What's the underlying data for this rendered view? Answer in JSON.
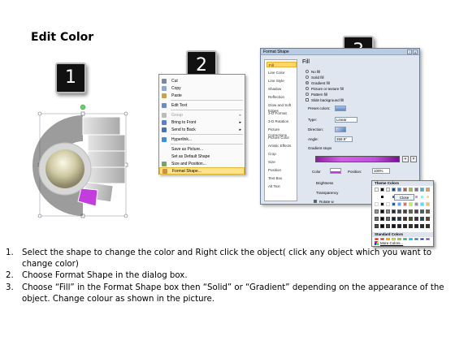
{
  "title": "Edit Color",
  "badges": [
    "1",
    "2",
    "3"
  ],
  "colors": {
    "badge_bg": "#111111",
    "highlight_segment": "#c33cdd",
    "menu_highlight": "#ffe38a",
    "dialog_bg": "#dfe6ef",
    "gradient_start": "#8a1fa0",
    "gradient_end": "#7b1290"
  },
  "context_menu": {
    "items": [
      {
        "label": "Cut",
        "icon": "scissors-icon"
      },
      {
        "label": "Copy",
        "icon": "copy-icon"
      },
      {
        "label": "Paste",
        "icon": "paste-icon"
      },
      {
        "label": "Edit Text",
        "icon": "text-icon"
      },
      {
        "label": "Group",
        "icon": "group-icon",
        "disabled": true,
        "submenu": true
      },
      {
        "label": "Bring to Front",
        "icon": "bring-front-icon",
        "submenu": true
      },
      {
        "label": "Send to Back",
        "icon": "send-back-icon",
        "submenu": true
      },
      {
        "label": "Hyperlink...",
        "icon": "hyperlink-icon"
      },
      {
        "label": "Save as Picture...",
        "icon": ""
      },
      {
        "label": "Set as Default Shape",
        "icon": ""
      },
      {
        "label": "Size and Position...",
        "icon": "size-position-icon"
      },
      {
        "label": "Format Shape...",
        "icon": "format-shape-icon",
        "highlighted": true
      }
    ]
  },
  "dialog": {
    "title": "Format Shape",
    "controls": [
      "?",
      "X"
    ],
    "categories": [
      "Fill",
      "Line Color",
      "Line Style",
      "Shadow",
      "Reflection",
      "Glow and Soft Edges",
      "3-D Format",
      "3-D Rotation",
      "Picture Corrections",
      "Picture Color",
      "Artistic Effects",
      "Crop",
      "Size",
      "Position",
      "Text Box",
      "Alt Text"
    ],
    "selected_category": "Fill",
    "pane_title": "Fill",
    "fill_options": [
      "No fill",
      "Solid fill",
      "Gradient fill",
      "Picture or texture fill",
      "Pattern fill",
      "Slide background fill"
    ],
    "selected_fill": "Gradient fill",
    "preset_colors_label": "Preset colors:",
    "type_label": "Type:",
    "type_value": "Linear",
    "direction_label": "Direction:",
    "angle_label": "Angle:",
    "angle_value": "359.9°",
    "gradient_stops_label": "Gradient stops",
    "color_label": "Color",
    "position_label": "Position:",
    "position_value": "100%",
    "brightness_label": "Brightness",
    "transparency_label": "Transparency",
    "rotate_label": "Rotate w",
    "theme_colors_label": "Theme Colors",
    "standard_colors_label": "Standard Colors",
    "more_colors_label": "More Colors...",
    "close_label": "Close"
  },
  "instructions": [
    {
      "num": "1.",
      "text": "Select the shape to change the color and Right click the object( click any object which you want to change color)"
    },
    {
      "num": "2.",
      "text": "Choose Format Shape in the dialog box."
    },
    {
      "num": "3.",
      "text": "Choose “Fill” in the Format Shape box then “Solid” or “Gradient” depending on the appearance of the object. Change colour as shown in the picture."
    }
  ]
}
